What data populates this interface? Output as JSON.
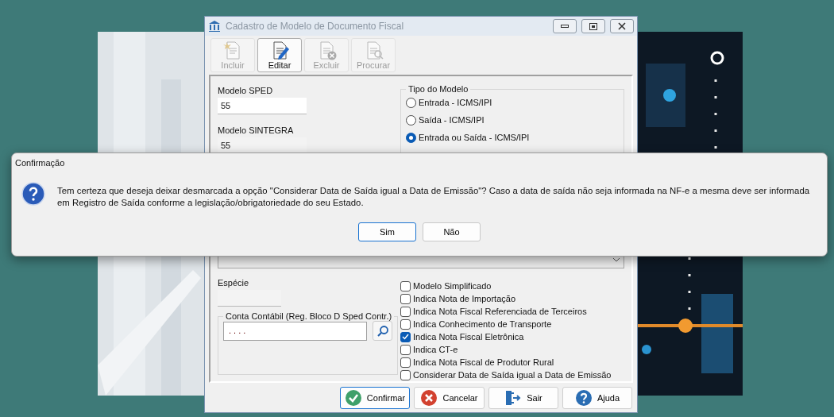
{
  "window": {
    "title": "Cadastro de Modelo de Documento Fiscal",
    "active": false
  },
  "toolbar": [
    {
      "label": "Incluir",
      "kind": "new",
      "disabled": true
    },
    {
      "label": "Editar",
      "kind": "edit",
      "disabled": false
    },
    {
      "label": "Excluir",
      "kind": "delete",
      "disabled": true
    },
    {
      "label": "Procurar",
      "kind": "find",
      "disabled": true
    }
  ],
  "form": {
    "modelo_sped": {
      "label": "Modelo SPED",
      "value": "55"
    },
    "modelo_sintegra": {
      "label": "Modelo SINTEGRA",
      "value": "55"
    },
    "tipo_do_modelo": {
      "title": "Tipo do Modelo",
      "options": [
        {
          "label": "Entrada - ICMS/IPI",
          "selected": false
        },
        {
          "label": "Saída - ICMS/IPI",
          "selected": false
        },
        {
          "label": "Entrada ou Saída - ICMS/IPI",
          "selected": true
        }
      ]
    },
    "especie": {
      "label": "Espécie"
    },
    "conta_contabil": {
      "title": "Conta Contábil (Reg. Bloco D Sped Contr.)",
      "value": ". . . ."
    },
    "options": [
      {
        "label": "Modelo Simplificado",
        "checked": false
      },
      {
        "label": "Indica Nota de Importação",
        "checked": false
      },
      {
        "label": "Indica Nota Fiscal Referenciada de Terceiros",
        "checked": false
      },
      {
        "label": "Indica Conhecimento de Transporte",
        "checked": false
      },
      {
        "label": "Indica Nota Fiscal Eletrônica",
        "checked": true
      },
      {
        "label": "Indica CT-e",
        "checked": false
      },
      {
        "label": "Indica Nota Fiscal de Produtor Rural",
        "checked": false
      },
      {
        "label": "Considerar Data de Saída igual a Data de Emissão",
        "checked": false
      }
    ]
  },
  "buttons": [
    {
      "label": "Confirmar",
      "kind": "confirm",
      "focused": true
    },
    {
      "label": "Cancelar",
      "kind": "cancel",
      "focused": false
    },
    {
      "label": "Sair",
      "kind": "exit",
      "focused": false
    },
    {
      "label": "Ajuda",
      "kind": "help",
      "focused": false
    }
  ],
  "dialog": {
    "title": "Confirmação",
    "message": "Tem certeza que deseja deixar desmarcada a opção \"Considerar Data de Saída igual a Data de Emissão\"? Caso a data de saída não seja informada na NF-e a mesma deve ser informada em Registro de Saída conforme a legislação/obrigatoriedade do seu Estado.",
    "buttons": [
      {
        "label": "Sim",
        "focused": true
      },
      {
        "label": "Não",
        "focused": false
      }
    ]
  }
}
